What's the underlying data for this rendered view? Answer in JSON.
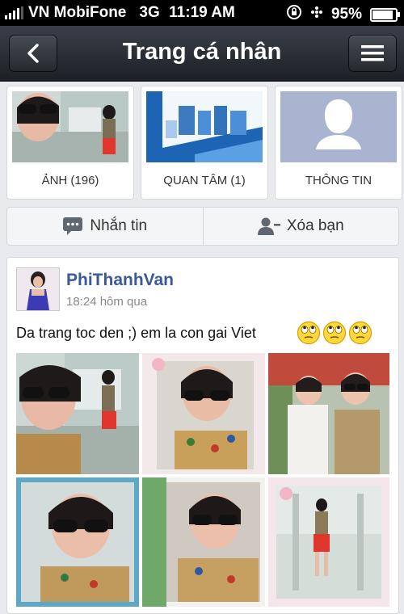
{
  "status_bar": {
    "carrier": "VN MobiFone",
    "network": "3G",
    "time": "11:19 AM",
    "battery": "95%",
    "battery_level": 0.95
  },
  "nav": {
    "title": "Trang cá nhân",
    "back_icon": "chevron-left-icon",
    "menu_icon": "hamburger-menu-icon"
  },
  "cards": [
    {
      "label": "ẢNH (196)"
    },
    {
      "label": "QUAN TÂM (1)"
    },
    {
      "label": "THÔNG TIN"
    }
  ],
  "actions": {
    "message_label": "Nhắn tin",
    "unfriend_label": "Xóa bạn"
  },
  "post": {
    "author": "PhiThanhVan",
    "time": "18:24 hôm qua",
    "text": "Da trang toc den ;) em la con gai Viet",
    "emoticon_count": 3
  },
  "colors": {
    "link": "#3b5998",
    "nav_dark": "#1c2026",
    "background": "#e9eaed"
  }
}
